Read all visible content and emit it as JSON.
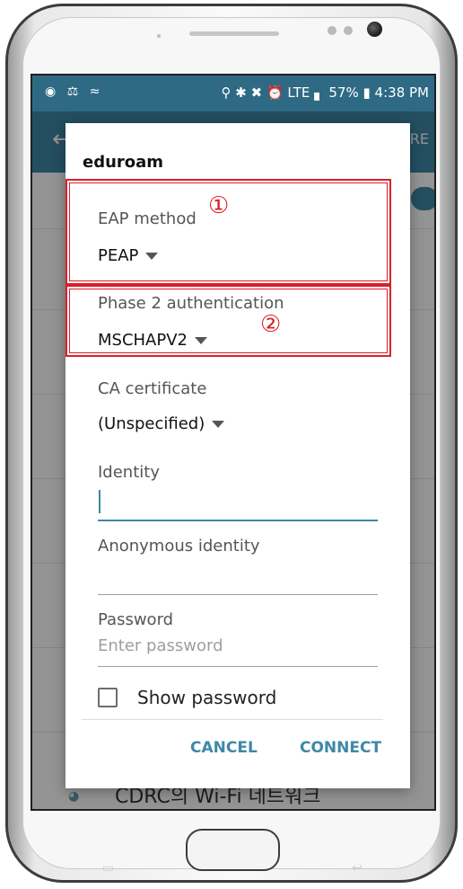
{
  "status_bar": {
    "left_icons": "◉ ⚖ ≈",
    "right_text": "⚲ ✱ ✖ ⏰ LTE ▖ 57% ▮ 4:38 PM"
  },
  "app_bar": {
    "back_icon": "arrow-left-icon",
    "right_label": "RE"
  },
  "background_list": {
    "last_network_label": "CDRC의 Wi-Fi 네트워크"
  },
  "dialog": {
    "title": "eduroam",
    "eap_method": {
      "label": "EAP method",
      "value": "PEAP"
    },
    "phase2": {
      "label": "Phase 2 authentication",
      "value": "MSCHAPV2"
    },
    "ca_certificate": {
      "label": "CA certificate",
      "value": "(Unspecified)"
    },
    "identity": {
      "label": "Identity",
      "value": ""
    },
    "anonymous_identity": {
      "label": "Anonymous identity",
      "value": ""
    },
    "password": {
      "label": "Password",
      "placeholder": "Enter password"
    },
    "show_password": {
      "label": "Show password",
      "checked": false
    },
    "buttons": {
      "cancel": "CANCEL",
      "connect": "CONNECT"
    }
  },
  "annotations": {
    "one": "①",
    "two": "②"
  },
  "colors": {
    "accent": "#3e88a7",
    "statusbar": "#2e6a84",
    "annotation": "#d8202a"
  }
}
